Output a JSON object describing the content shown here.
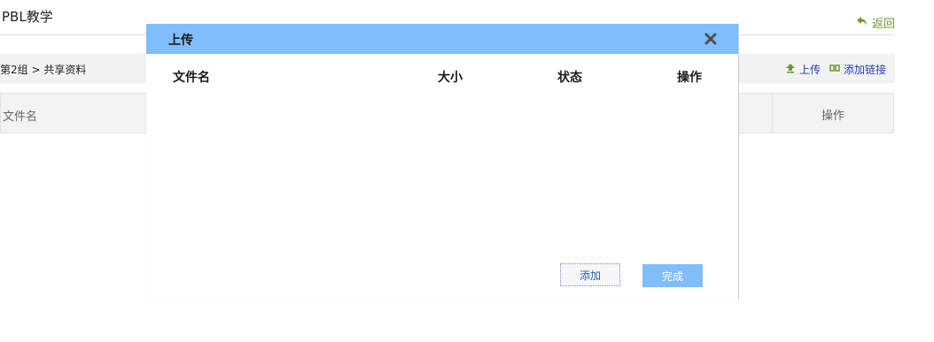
{
  "page": {
    "title": "PBL教学",
    "back_label": "返回",
    "breadcrumb": "第2组 > 共享资料",
    "actions": {
      "upload": "上传",
      "add_link": "添加链接"
    },
    "table": {
      "col_name": "文件名",
      "col_op": "操作"
    }
  },
  "dialog": {
    "title": "上传",
    "columns": {
      "name": "文件名",
      "size": "大小",
      "status": "状态",
      "op": "操作"
    },
    "add_button": "添加",
    "done_button": "完成"
  },
  "colors": {
    "header_blue": "#80bdfb",
    "back_green": "#6a9a2a",
    "link_blue": "#2b3fae"
  },
  "icons": [
    "return-arrow-icon",
    "upload-arrow-icon",
    "link-icon",
    "close-icon"
  ]
}
